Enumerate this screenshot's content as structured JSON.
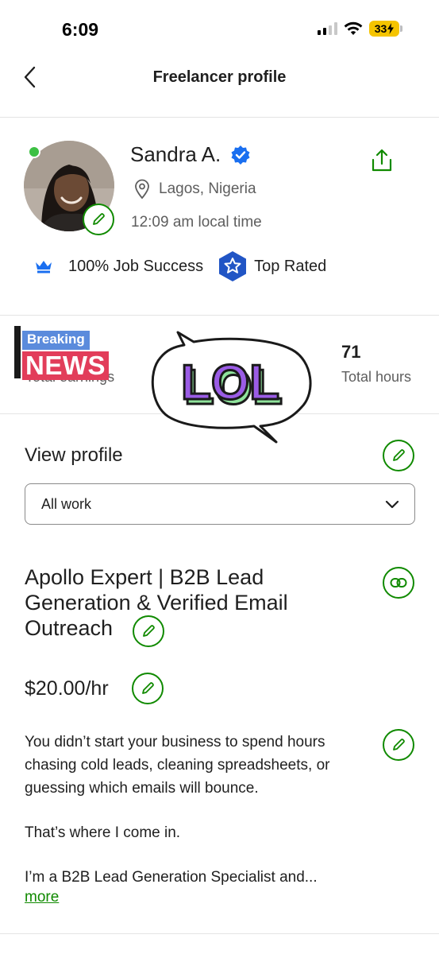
{
  "status_bar": {
    "time": "6:09",
    "battery": "33"
  },
  "nav": {
    "title": "Freelancer profile"
  },
  "profile": {
    "name": "Sandra A.",
    "location": "Lagos, Nigeria",
    "local_time": "12:09 am local time",
    "job_success": "100% Job Success",
    "top_rated": "Top Rated"
  },
  "stats": {
    "earnings_label": "Total earnings",
    "hours_value": "71",
    "hours_label": "Total hours"
  },
  "stickers": {
    "news_top": "Breaking",
    "news_main": "NEWS",
    "lol_text": "LOL"
  },
  "section": {
    "title": "View profile",
    "filter_value": "All work"
  },
  "job": {
    "title": "Apollo Expert | B2B Lead Generation & Verified Email Outreach",
    "rate": "$20.00/hr"
  },
  "bio": {
    "paragraph_1": "You didn’t start your business to spend hours chasing cold leads, cleaning spreadsheets, or guessing which emails will bounce.",
    "paragraph_2": "That’s where I come in.",
    "paragraph_3": "I’m a B2B Lead Generation Specialist and...",
    "more_label": "more"
  },
  "colors": {
    "accent": "#108a00",
    "verified": "#1a6ff0",
    "top_rated": "#2155c5"
  }
}
